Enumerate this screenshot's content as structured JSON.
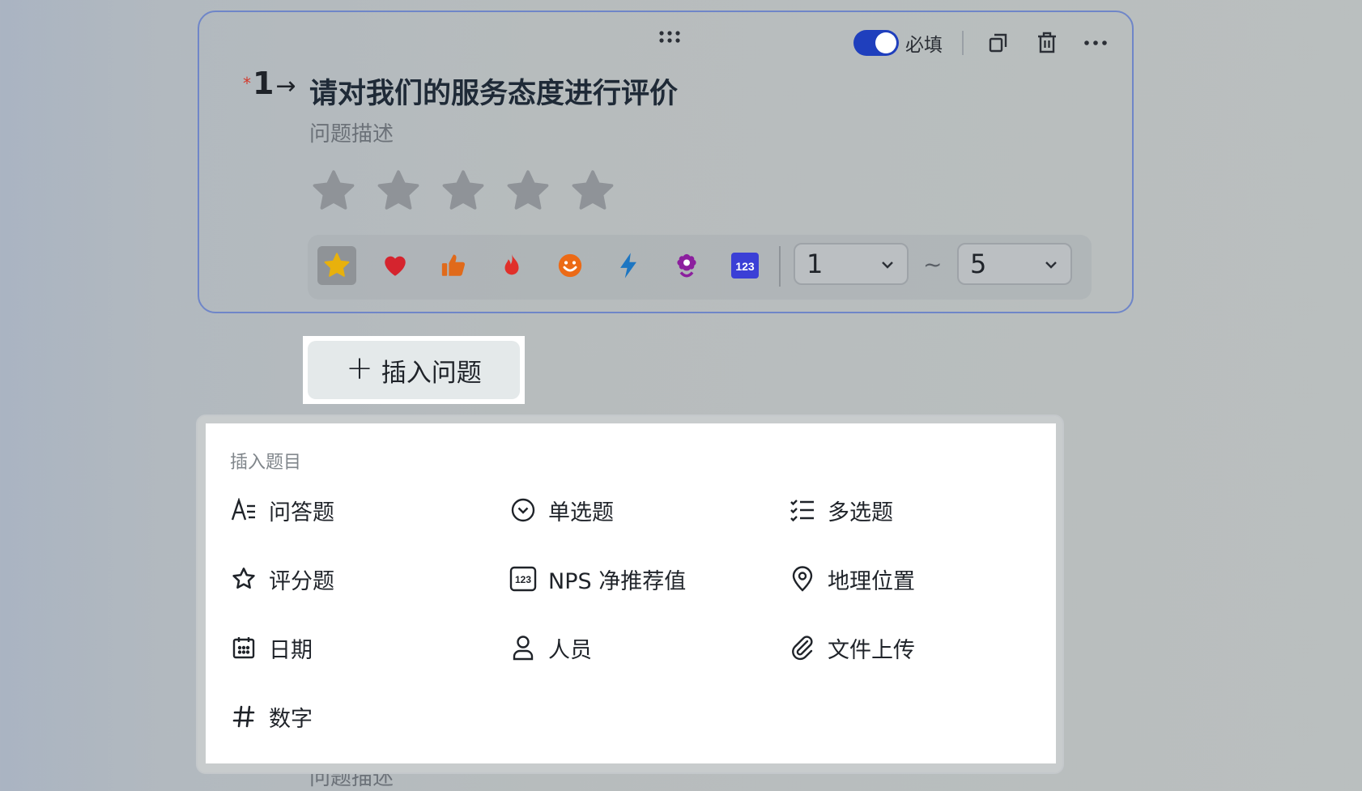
{
  "question": {
    "required_mark": "*",
    "number": "1",
    "arrow": "→",
    "title": "请对我们的服务态度进行评价",
    "description": "问题描述",
    "star_count": 5,
    "toolbar": {
      "required_label": "必填",
      "required_on": true
    },
    "rating_styles": [
      {
        "name": "star",
        "selected": true
      },
      {
        "name": "heart",
        "selected": false
      },
      {
        "name": "thumbs-up",
        "selected": false
      },
      {
        "name": "fire",
        "selected": false
      },
      {
        "name": "smile",
        "selected": false
      },
      {
        "name": "lightning",
        "selected": false
      },
      {
        "name": "flower",
        "selected": false
      },
      {
        "name": "number-123",
        "selected": false
      }
    ],
    "number_icon_text": "123",
    "range": {
      "min": "1",
      "separator": "~",
      "max": "5"
    }
  },
  "insert_button": {
    "plus": "+",
    "label": "插入问题"
  },
  "insert_menu": {
    "title": "插入题目",
    "items": [
      {
        "label": "问答题",
        "icon": "text-answer-icon"
      },
      {
        "label": "单选题",
        "icon": "single-choice-icon"
      },
      {
        "label": "多选题",
        "icon": "multi-choice-icon"
      },
      {
        "label": "评分题",
        "icon": "star-outline-icon"
      },
      {
        "label": "NPS 净推荐值",
        "icon": "nps-icon"
      },
      {
        "label": "地理位置",
        "icon": "location-pin-icon"
      },
      {
        "label": "日期",
        "icon": "calendar-icon"
      },
      {
        "label": "人员",
        "icon": "person-icon"
      },
      {
        "label": "文件上传",
        "icon": "paperclip-icon"
      },
      {
        "label": "数字",
        "icon": "hash-icon"
      }
    ],
    "nps_icon_text": "123"
  },
  "behind_description": "问题描述",
  "colors": {
    "accent": "#1f3fbd",
    "card_border": "#6f86c8",
    "required": "#d33a2c",
    "star_gray": "#8f9398"
  }
}
